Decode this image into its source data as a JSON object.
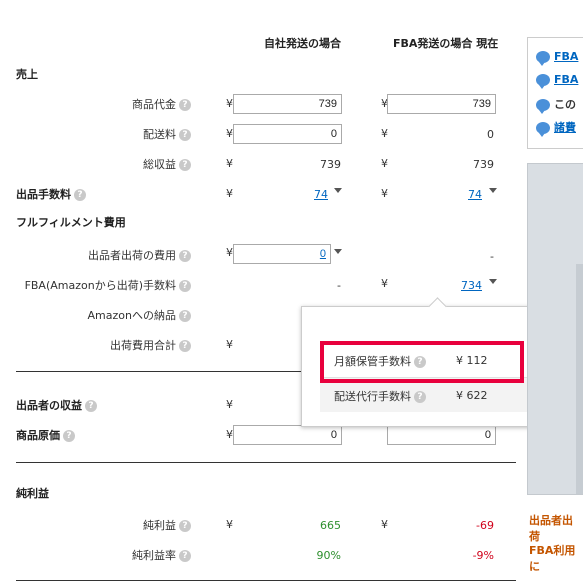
{
  "columns": {
    "own": "自社発送の場合",
    "fba": "FBA発送の場合 現在"
  },
  "currency": "¥",
  "sections": {
    "sales": "売上",
    "fulfillment": "フルフィルメント費用",
    "net": "純利益"
  },
  "rows": {
    "item_price": {
      "label": "商品代金",
      "own": "739",
      "fba": "739"
    },
    "shipping": {
      "label": "配送料",
      "own": "0",
      "fba": "0"
    },
    "total_revenue": {
      "label": "総収益",
      "own": "739",
      "fba": "739"
    },
    "selling_fee": {
      "label": "出品手数料",
      "own": "74",
      "fba": "74"
    },
    "seller_ship_cost": {
      "label": "出品者出荷の費用",
      "own": "0",
      "fba": "-"
    },
    "fba_fee": {
      "label": "FBA(Amazonから出荷)手数料",
      "own": "-",
      "fba": "734"
    },
    "amazon_delivery": {
      "label": "Amazonへの納品"
    },
    "ship_total": {
      "label": "出荷費用合計"
    },
    "seller_income": {
      "label": "出品者の収益"
    },
    "cost": {
      "label": "商品原価",
      "own": "0",
      "fba": "0"
    },
    "net_profit": {
      "label": "純利益",
      "own": "665",
      "fba": "-69"
    },
    "net_margin": {
      "label": "純利益率",
      "own": "90%",
      "fba": "-9%"
    }
  },
  "popup": {
    "monthly_storage": {
      "label": "月額保管手数料",
      "value": "¥ 112"
    },
    "delivery_agent": {
      "label": "配送代行手数料",
      "value": "¥ 622"
    },
    "close": "×"
  },
  "sidebar": {
    "links": [
      "FBA",
      "FBA",
      "この",
      "諸費"
    ],
    "notes": [
      "出品者出荷",
      "FBA利用に"
    ]
  },
  "colors": {
    "highlight": "#e8003d",
    "link": "#0066c0",
    "positive": "#2d8f2d",
    "negative": "#d0021b",
    "note": "#c45500"
  }
}
